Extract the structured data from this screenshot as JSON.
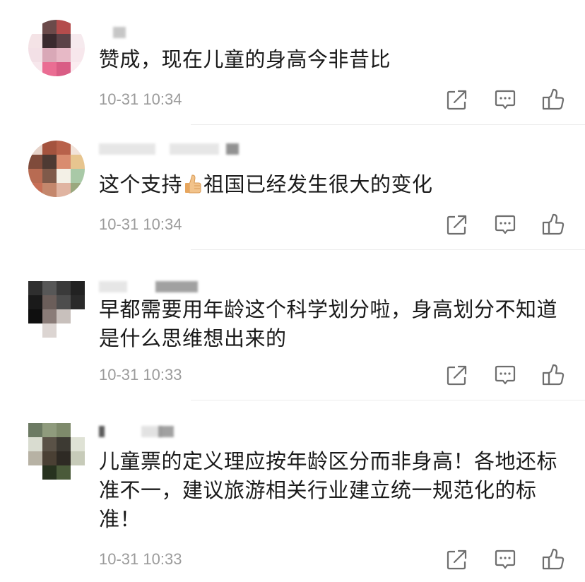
{
  "comments": [
    {
      "text": "赞成，现在儿童的身高今非昔比",
      "time": "10-31 10:34",
      "avatar_colors": [
        "#ffffff",
        "#6b4a4a",
        "#b44c4c",
        "#ffffff",
        "#f4e3e6",
        "#3a2a2e",
        "#5b4247",
        "#f6eaee",
        "#f3e0e6",
        "#d9a8b7",
        "#e7b9c6",
        "#f7e7ec",
        "#f7e7ec",
        "#ea6d93",
        "#d95d85",
        "#fbecf0"
      ]
    },
    {
      "text_before": "这个支持",
      "text_after": "祖国已经发生很大的变化",
      "emoji": "thumbs-up-emoji",
      "time": "10-31 10:34",
      "avatar_colors": [
        "#e6d2c8",
        "#a4533e",
        "#b8614a",
        "#f2e3d9",
        "#7f4b3b",
        "#4e3a33",
        "#d98c6f",
        "#e7c58f",
        "#b86b52",
        "#7f5a4a",
        "#f3f0e6",
        "#a9c9a7",
        "#c76f56",
        "#c4876c",
        "#e0b4a1",
        "#9aa87e"
      ]
    },
    {
      "text": "早都需要用年龄这个科学划分啦，身高划分不知道是什么思维想出来的",
      "time": "10-31 10:33",
      "avatar_colors": [
        "#2f2f2f",
        "#575757",
        "#3a3a3a",
        "#222222",
        "#1a1a1a",
        "#6b5e5a",
        "#4d4d4d",
        "#2a2a2a",
        "#0f0f0f",
        "#8a7c78",
        "#c8c0bc",
        "#ffffff",
        "#ffffff",
        "#dcd5d2",
        "#ffffff",
        "#ffffff"
      ]
    },
    {
      "text": "儿童票的定义理应按年龄区分而非身高！各地还标准不一，建议旅游相关行业建立统一规范化的标准！",
      "time": "10-31 10:33",
      "avatar_colors": [
        "#6c7a63",
        "#8f9b7d",
        "#7e8a6b",
        "#ffffff",
        "#d9dcd0",
        "#5a5247",
        "#3d3a33",
        "#dfe2d5",
        "#b7b2a4",
        "#4a4034",
        "#2e2a24",
        "#c7cbb9",
        "#ffffff",
        "#27321f",
        "#4a5a3a",
        "#ffffff"
      ]
    }
  ],
  "icons": {
    "share": "share-icon",
    "reply": "comment-icon",
    "like": "thumbs-up-icon"
  },
  "colors": {
    "text": "#1a1a1a",
    "time": "#9b9b9b",
    "icon": "#6e6e6e",
    "divider": "#ececec"
  }
}
